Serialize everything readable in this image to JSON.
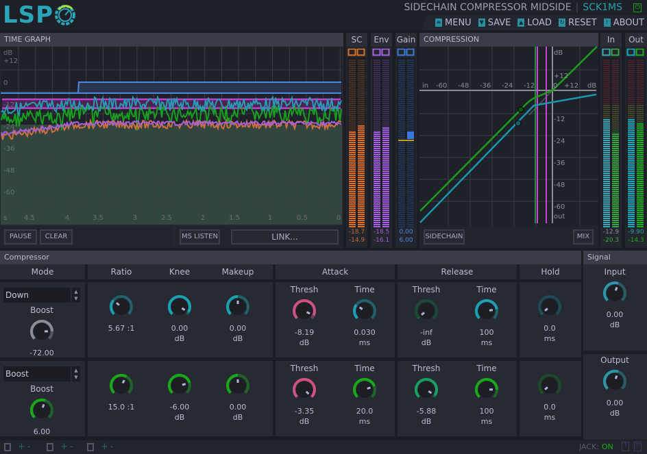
{
  "header": {
    "logo": "LSP",
    "plugin_title": "SIDECHAIN COMPRESSOR MIDSIDE",
    "plugin_code": "SCK1MS",
    "menu": [
      {
        "label": "MENU",
        "icon": "menu-icon"
      },
      {
        "label": "SAVE",
        "icon": "save-icon"
      },
      {
        "label": "LOAD",
        "icon": "load-icon"
      },
      {
        "label": "RESET",
        "icon": "reset-icon"
      },
      {
        "label": "ABOUT",
        "icon": "about-icon"
      }
    ]
  },
  "time_graph": {
    "title": "TIME GRAPH",
    "y_labels": [
      "dB",
      "+12",
      "0",
      "-12",
      "-24",
      "-36",
      "-48",
      "-60"
    ],
    "x_labels": [
      "s",
      "4.5",
      "4",
      "3.5",
      "3",
      "2.5",
      "2",
      "1.5",
      "1",
      "0.5",
      "0"
    ],
    "buttons": {
      "pause": "PAUSE",
      "clear": "CLEAR",
      "ms_listen": "MS LISTEN",
      "link": "LINK..."
    }
  },
  "meters": [
    {
      "id": "sc",
      "label": "SC",
      "colors": [
        "#e07020",
        "#e07020"
      ],
      "levels": [
        0.57,
        0.6
      ],
      "values": [
        "-18.7",
        "-14.9"
      ],
      "value_color": "#c8682a"
    },
    {
      "id": "env",
      "label": "Env",
      "colors": [
        "#a860e8",
        "#a860e8"
      ],
      "levels": [
        0.57,
        0.59
      ],
      "values": [
        "-18.5",
        "-16.1"
      ],
      "value_color": "#a060d0"
    },
    {
      "id": "gain",
      "label": "Gain",
      "colors": [
        "#3a78e0",
        "#3a78e0"
      ],
      "levels": [
        0.0,
        0.0
      ],
      "values": [
        "0.00",
        "6.00"
      ],
      "value_color": "#4a88e8"
    },
    {
      "id": "in",
      "label": "In",
      "colors": [
        "#3aa8b8",
        "#38a840"
      ],
      "levels": [
        0.64,
        0.56
      ],
      "values": [
        "-12.9",
        "-20.3"
      ],
      "value_color": "#8a8ea0"
    },
    {
      "id": "out",
      "label": "Out",
      "colors": [
        "#18a8c0",
        "#18b018"
      ],
      "levels": [
        0.64,
        0.62
      ],
      "values": [
        "-9.90",
        "-14.3"
      ],
      "value_color": "#2aa0a0"
    }
  ],
  "compression": {
    "title": "COMPRESSION",
    "in_labels": [
      "in",
      "-60",
      "-48",
      "-36",
      "-24",
      "-12",
      "0",
      "+12",
      "dB"
    ],
    "out_labels": [
      "dB",
      "+12",
      "-12",
      "-24",
      "-36",
      "-48",
      "-60",
      "out"
    ],
    "buttons": {
      "sidechain": "SIDECHAIN",
      "mix": "MIX"
    }
  },
  "compressor": {
    "title": "Compressor",
    "columns": {
      "mode": "Mode",
      "ratio": "Ratio",
      "knee": "Knee",
      "makeup": "Makeup",
      "attack": "Attack",
      "release": "Release",
      "hold": "Hold"
    },
    "rows": [
      {
        "mode": "Down",
        "boost": {
          "label": "Boost",
          "value": "-72.00",
          "level": 0.83,
          "color": "#8a8c96"
        },
        "ratio": {
          "value": "5.67 :1",
          "unit": "",
          "level": 0.31,
          "color": "#1aa0b0"
        },
        "knee": {
          "value": "0.00",
          "unit": "dB",
          "level": 0.95,
          "color": "#1aa0b0"
        },
        "makeup": {
          "value": "0.00",
          "unit": "dB",
          "level": 0.5,
          "color": "#1aa0b0"
        },
        "attack_thresh": {
          "label": "Thresh",
          "value": "-8.19",
          "unit": "dB",
          "level": 0.93,
          "color": "#d05080"
        },
        "attack_time": {
          "label": "Time",
          "value": "0.030",
          "unit": "ms",
          "level": 0.3,
          "color": "#1aa0b0"
        },
        "release_thresh": {
          "label": "Thresh",
          "value": "-inf",
          "unit": "dB",
          "level": 0.02,
          "color": "#107040"
        },
        "release_time": {
          "label": "Time",
          "value": "100",
          "unit": "ms",
          "level": 0.8,
          "color": "#1aa0b0"
        },
        "hold": {
          "value": "0.0",
          "unit": "ms",
          "level": 0.02,
          "color": "#107080"
        }
      },
      {
        "mode": "Boost",
        "boost": {
          "label": "Boost",
          "value": "6.00",
          "level": 0.57,
          "color": "#18a818"
        },
        "ratio": {
          "value": "15.0 :1",
          "unit": "",
          "level": 0.61,
          "color": "#18a818"
        },
        "knee": {
          "value": "-6.00",
          "unit": "dB",
          "level": 0.78,
          "color": "#18a818"
        },
        "makeup": {
          "value": "0.00",
          "unit": "dB",
          "level": 0.5,
          "color": "#18a818"
        },
        "attack_thresh": {
          "label": "Thresh",
          "value": "-3.35",
          "unit": "dB",
          "level": 1.0,
          "color": "#d05080"
        },
        "attack_time": {
          "label": "Time",
          "value": "20.0",
          "unit": "ms",
          "level": 0.76,
          "color": "#18a818"
        },
        "release_thresh": {
          "label": "Thresh",
          "value": "-5.88",
          "unit": "dB",
          "level": 0.96,
          "color": "#18a060"
        },
        "release_time": {
          "label": "Time",
          "value": "100",
          "unit": "ms",
          "level": 0.83,
          "color": "#18a818"
        },
        "hold": {
          "value": "0.0",
          "unit": "ms",
          "level": 0.02,
          "color": "#107018"
        }
      }
    ]
  },
  "signal": {
    "title": "Signal",
    "input": {
      "label": "Input",
      "value": "0.00",
      "unit": "dB",
      "level": 0.57,
      "color": "#2a98a8"
    },
    "output": {
      "label": "Output",
      "value": "0.00",
      "unit": "dB",
      "level": 0.57,
      "color": "#2a98a8"
    }
  },
  "footer": {
    "jack_label": "JACK:",
    "jack_status": "ON",
    "help": "?",
    "jack_color": "#18b018"
  }
}
